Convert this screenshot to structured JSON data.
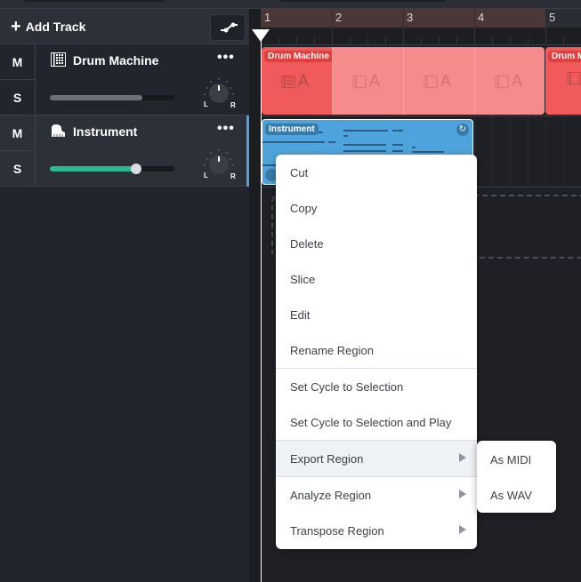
{
  "toolbar": {
    "add_track_label": "Add Track",
    "add_track_icon": "plus-icon",
    "automation_icon": "automation-curve-icon"
  },
  "tracks": [
    {
      "name": "Drum Machine",
      "icon": "drum-grid-icon",
      "mute_label": "M",
      "solo_label": "S",
      "more_label": "•••",
      "volume": 0.74,
      "volume_color": "#6e7178",
      "pan": 0,
      "pan_left_label": "L",
      "pan_right_label": "R",
      "selected": false
    },
    {
      "name": "Instrument",
      "icon": "piano-icon",
      "mute_label": "M",
      "solo_label": "S",
      "more_label": "•••",
      "volume": 0.69,
      "volume_color": "#2bb894",
      "pan": 0,
      "pan_left_label": "L",
      "pan_right_label": "R",
      "selected": true
    }
  ],
  "ruler": {
    "bars": [
      "1",
      "2",
      "3",
      "4",
      "5"
    ],
    "cycle_range": [
      "1",
      "5"
    ]
  },
  "regions": {
    "drum": {
      "name": "Drum Machine",
      "pattern_label": "A",
      "color": "#f05a5a",
      "loop_color": "#f58b8b"
    },
    "drum_next": {
      "name": "Drum Machine"
    },
    "instrument": {
      "name": "Instrument",
      "color": "#4fa3dc",
      "loop_icon": "loop-icon"
    }
  },
  "context_menu": {
    "items": [
      {
        "label": "Cut"
      },
      {
        "label": "Copy"
      },
      {
        "label": "Delete"
      },
      {
        "label": "Slice"
      },
      {
        "label": "Edit"
      },
      {
        "label": "Rename Region"
      },
      {
        "label": "Set Cycle to Selection"
      },
      {
        "label": "Set Cycle to Selection and Play"
      },
      {
        "label": "Export Region",
        "submenu": true,
        "active": true
      },
      {
        "label": "Analyze Region",
        "submenu": true
      },
      {
        "label": "Transpose Region",
        "submenu": true
      }
    ],
    "submenu": {
      "parent": "Export Region",
      "items": [
        {
          "label": "As MIDI"
        },
        {
          "label": "As WAV"
        }
      ]
    }
  }
}
